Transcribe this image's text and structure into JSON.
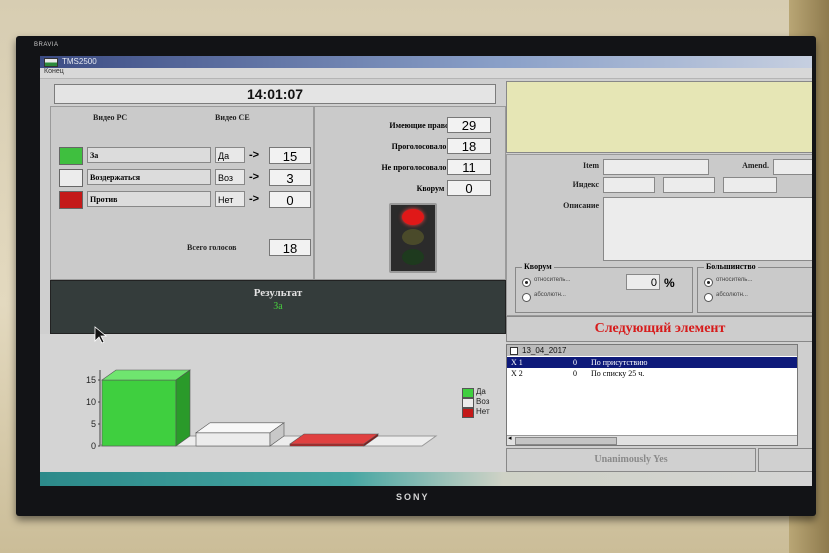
{
  "tv": {
    "brand_top": "BRAVIA",
    "brand_bottom": "SONY"
  },
  "app": {
    "title": "TMS2500",
    "menu": "Конец",
    "clock": "14:01:07"
  },
  "vote": {
    "header_pc": "Видео PC",
    "header_ce": "Видео CE",
    "rows": [
      {
        "label": "За",
        "code": "Да",
        "arrow": "->",
        "value": "15",
        "color": "#3fbf3f"
      },
      {
        "label": "Воздержаться",
        "code": "Воз",
        "arrow": "->",
        "value": "3",
        "color": "#ececec"
      },
      {
        "label": "Против",
        "code": "Нет",
        "arrow": "->",
        "value": "0",
        "color": "#c41919"
      }
    ],
    "total_label": "Всего голосов",
    "total_value": "18"
  },
  "stats": [
    {
      "label": "Имеющие право",
      "value": "29"
    },
    {
      "label": "Проголосовало:",
      "value": "18"
    },
    {
      "label": "Не проголосовало:",
      "value": "11"
    },
    {
      "label": "Кворум :",
      "value": "0"
    }
  ],
  "traffic_light": {
    "active": "red"
  },
  "result": {
    "title": "Результат",
    "value": "За"
  },
  "item_form": {
    "item_label": "Item",
    "amend_label": "Amend.",
    "index_label": "Индекс",
    "desc_label": "Описание",
    "quorum_group": "Кворум",
    "quorum_opt1": "относитель...",
    "quorum_opt2": "абсолютн...",
    "quorum_value": "0",
    "quorum_unit": "%",
    "majority_group": "Большинство",
    "majority_opt1": "относитель...",
    "majority_opt2": "абсолютн..."
  },
  "next_button": "Следующий элемент",
  "list": {
    "header": "13_04_2017",
    "rows": [
      {
        "id": "X 1",
        "num": "0",
        "text": "По присутствию",
        "selected": true
      },
      {
        "id": "X 2",
        "num": "0",
        "text": "По списку 25 ч.",
        "selected": false
      }
    ]
  },
  "unanimously_button": "Unanimously Yes",
  "chart_data": {
    "type": "bar",
    "categories": [
      "Да",
      "Воз",
      "Нет"
    ],
    "values": [
      15,
      3,
      0
    ],
    "colors": [
      "#3fcf3f",
      "#ececec",
      "#c41919"
    ],
    "yticks": [
      "15",
      "10",
      "5",
      "0"
    ],
    "ylim": [
      0,
      15
    ],
    "legend": [
      "Да",
      "Воз",
      "Нет"
    ]
  }
}
